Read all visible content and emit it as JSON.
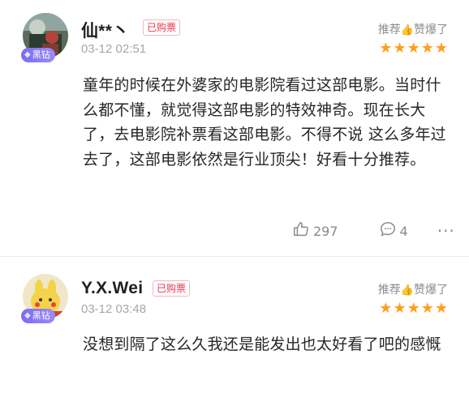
{
  "reviews": [
    {
      "username": "仙**丶",
      "purchased_label": "已购票",
      "badge": "黑钻",
      "time": "03-12 02:51",
      "recommend": "推荐",
      "rating_text": "赞爆了",
      "stars": 5,
      "content": "童年的时候在外婆家的电影院看过这部电影。当时什么都不懂，就觉得这部电影的特效神奇。现在长大了，去电影院补票看这部电影。不得不说 这么多年过去了，这部电影依然是行业顶尖！好看十分推荐。",
      "likes": "297",
      "comments": "4"
    },
    {
      "username": "Y.X.Wei",
      "purchased_label": "已购票",
      "badge": "黑钻",
      "time": "03-12 03:48",
      "recommend": "推荐",
      "rating_text": "赞爆了",
      "stars": 5,
      "content": "没想到隔了这么久我还是能发出也太好看了吧的感慨"
    }
  ],
  "colors": {
    "accent_star": "#ff9e1a",
    "purchased": "#e8374f",
    "badge": "#8577f3"
  }
}
